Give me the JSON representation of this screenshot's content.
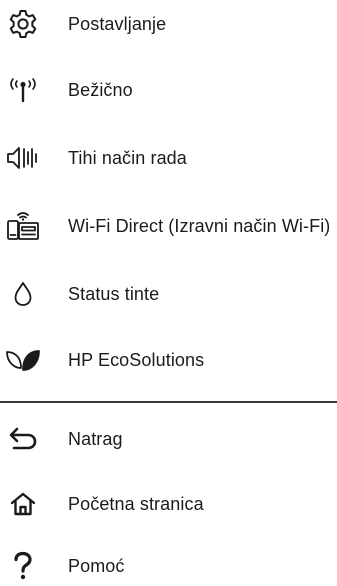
{
  "menu": {
    "items": [
      {
        "label": "Postavljanje",
        "icon": "gear-icon"
      },
      {
        "label": "Bežično",
        "icon": "wireless-antenna-icon"
      },
      {
        "label": "Tihi način rada",
        "icon": "quiet-mode-speaker-icon"
      },
      {
        "label": "Wi-Fi Direct (Izravni način Wi-Fi)",
        "icon": "wifi-direct-icon"
      },
      {
        "label": "Status tinte",
        "icon": "ink-drop-icon"
      },
      {
        "label": "HP EcoSolutions",
        "icon": "eco-leaf-icon"
      }
    ],
    "nav": [
      {
        "label": "Natrag",
        "icon": "back-arrow-icon"
      },
      {
        "label": "Početna stranica",
        "icon": "home-icon"
      },
      {
        "label": "Pomoć",
        "icon": "help-icon"
      }
    ]
  }
}
